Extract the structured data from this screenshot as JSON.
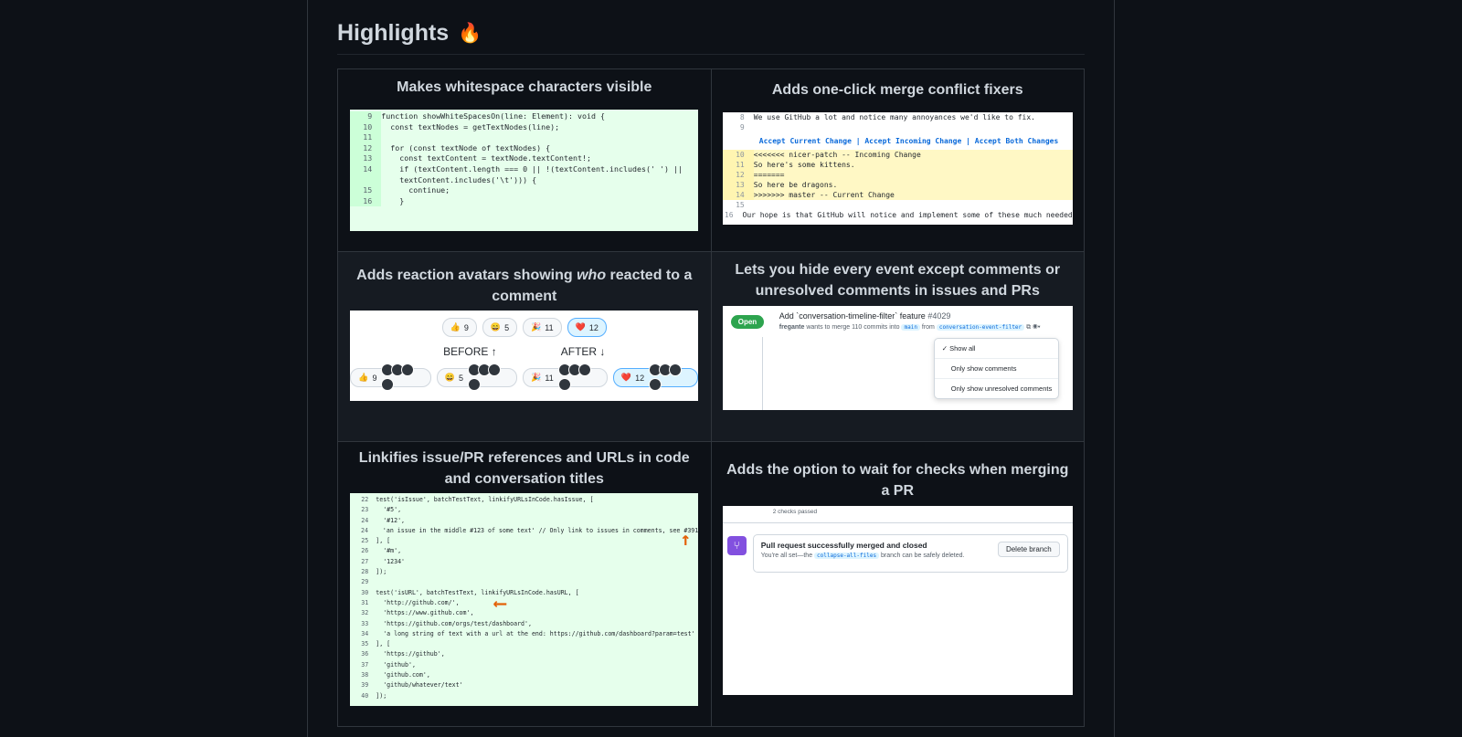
{
  "section": {
    "title": "Highlights",
    "emoji": "🔥"
  },
  "features": [
    {
      "caption": "Makes whitespace characters visible",
      "code": [
        {
          "n": "9",
          "t": "function showWhiteSpacesOn(line: Element): void {"
        },
        {
          "n": "10",
          "t": "  const textNodes = getTextNodes(line);"
        },
        {
          "n": "11",
          "t": ""
        },
        {
          "n": "12",
          "t": "  for (const textNode of textNodes) {"
        },
        {
          "n": "13",
          "t": "    const textContent = textNode.textContent!;"
        },
        {
          "n": "14",
          "t": "    if (textContent.length === 0 || !(textContent.includes(' ') ||"
        },
        {
          "n": "",
          "t": "    textContent.includes('\\t'))) {"
        },
        {
          "n": "15",
          "t": "      continue;"
        },
        {
          "n": "16",
          "t": "    }"
        }
      ]
    },
    {
      "caption": "Adds one-click merge conflict fixers",
      "top": [
        {
          "n": "8",
          "t": "We use GitHub a lot and notice many annoyances we'd like to fix."
        },
        {
          "n": "9",
          "t": ""
        }
      ],
      "links": "Accept Current Change | Accept Incoming Change | Accept Both Changes",
      "conflict": [
        {
          "n": "10",
          "t": "<<<<<<< nicer-patch -- Incoming Change"
        },
        {
          "n": "11",
          "t": "So here's some kittens."
        },
        {
          "n": "12",
          "t": "======="
        },
        {
          "n": "13",
          "t": "So here be dragons."
        },
        {
          "n": "14",
          "t": ">>>>>>> master -- Current Change"
        }
      ],
      "bottom": [
        {
          "n": "15",
          "t": ""
        },
        {
          "n": "16",
          "t": "Our hope is that GitHub will notice and implement some of these much needed"
        }
      ]
    },
    {
      "caption_a": "Adds reaction avatars showing ",
      "caption_em": "who",
      "caption_b": " reacted to a comment",
      "before_label": "BEFORE ↑",
      "after_label": "AFTER ↓",
      "reactions": [
        {
          "emoji": "👍",
          "count": "9"
        },
        {
          "emoji": "😄",
          "count": "5"
        },
        {
          "emoji": "🎉",
          "count": "11"
        },
        {
          "emoji": "❤️",
          "count": "12"
        }
      ]
    },
    {
      "caption": "Lets you hide every event except comments or unresolved comments in issues and PRs",
      "open": "Open",
      "pr_title": "Add `conversation-timeline-filter` feature",
      "pr_number": "#4029",
      "author": "fregante",
      "meta": "wants to merge 110 commits into",
      "base": "main",
      "from": "from",
      "head": "conversation-event-filter",
      "menu": [
        "✓ Show all",
        "Only show comments",
        "Only show unresolved comments"
      ]
    },
    {
      "caption": "Linkifies issue/PR references and URLs in code and conversation titles",
      "code": [
        {
          "n": "22",
          "t": "test('isIssue', batchTestText, linkifyURLsInCode.hasIssue, ["
        },
        {
          "n": "23",
          "t": "  '#5',"
        },
        {
          "n": "24",
          "t": "  '#12',"
        },
        {
          "n": "24",
          "t": "  'an issue in the middle #123 of some text' // Only link to issues in comments, see #391"
        },
        {
          "n": "25",
          "t": "], ["
        },
        {
          "n": "26",
          "t": "  '#m',"
        },
        {
          "n": "27",
          "t": "  '1234'"
        },
        {
          "n": "28",
          "t": "]);"
        },
        {
          "n": "29",
          "t": ""
        },
        {
          "n": "30",
          "t": "test('isURL', batchTestText, linkifyURLsInCode.hasURL, ["
        },
        {
          "n": "31",
          "t": "  'http://github.com/',"
        },
        {
          "n": "32",
          "t": "  'https://www.github.com',"
        },
        {
          "n": "33",
          "t": "  'https://github.com/orgs/test/dashboard',"
        },
        {
          "n": "34",
          "t": "  'a long string of text with a url at the end: https://github.com/dashboard?param=test'"
        },
        {
          "n": "35",
          "t": "], ["
        },
        {
          "n": "36",
          "t": "  'https://github',"
        },
        {
          "n": "37",
          "t": "  'github',"
        },
        {
          "n": "38",
          "t": "  'github.com',"
        },
        {
          "n": "39",
          "t": "  'github/whatever/text'"
        },
        {
          "n": "40",
          "t": "]);"
        }
      ]
    },
    {
      "caption": "Adds the option to wait for checks when merging a PR",
      "checks": "2 checks passed",
      "merged_title": "Pull request successfully merged and closed",
      "merged_desc_a": "You're all set—the",
      "branch": "collapse-all-files",
      "merged_desc_b": "branch can be safely deleted.",
      "delete_label": "Delete branch"
    }
  ]
}
